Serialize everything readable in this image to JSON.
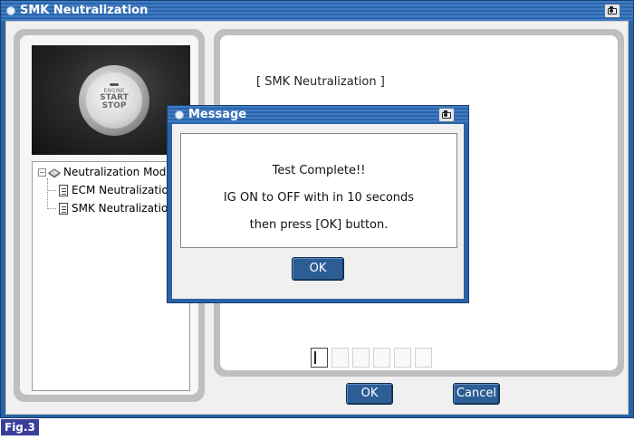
{
  "window": {
    "title": "SMK Neutralization"
  },
  "left_panel": {
    "photo": {
      "button_top_text": "ENGINE",
      "button_line2": "START",
      "button_line3": "STOP"
    },
    "tree": {
      "root": {
        "expander": "−",
        "label": "Neutralization Mode"
      },
      "children": [
        {
          "label": "ECM Neutralization"
        },
        {
          "label": "SMK Neutralization"
        }
      ]
    }
  },
  "right_panel": {
    "heading": "[ SMK Neutralization ]",
    "progress": {
      "total_cells": 6,
      "filled_cells": 1
    }
  },
  "footer": {
    "ok_label": "OK",
    "cancel_label": "Cancel"
  },
  "dialog": {
    "title": "Message",
    "lines": [
      "Test Complete!!",
      "IG ON to OFF with in 10 seconds",
      "then press [OK] button."
    ],
    "ok_label": "OK"
  },
  "figure_label": "Fig.3",
  "icons": {
    "title": "window-bullet-icon",
    "capture": "camera-icon",
    "tree_root": "folder-icon",
    "tree_child": "document-icon"
  },
  "colors": {
    "titlebar": "#2a63a5",
    "button": "#2d5d95",
    "figure_badge": "#3a3f9c"
  }
}
